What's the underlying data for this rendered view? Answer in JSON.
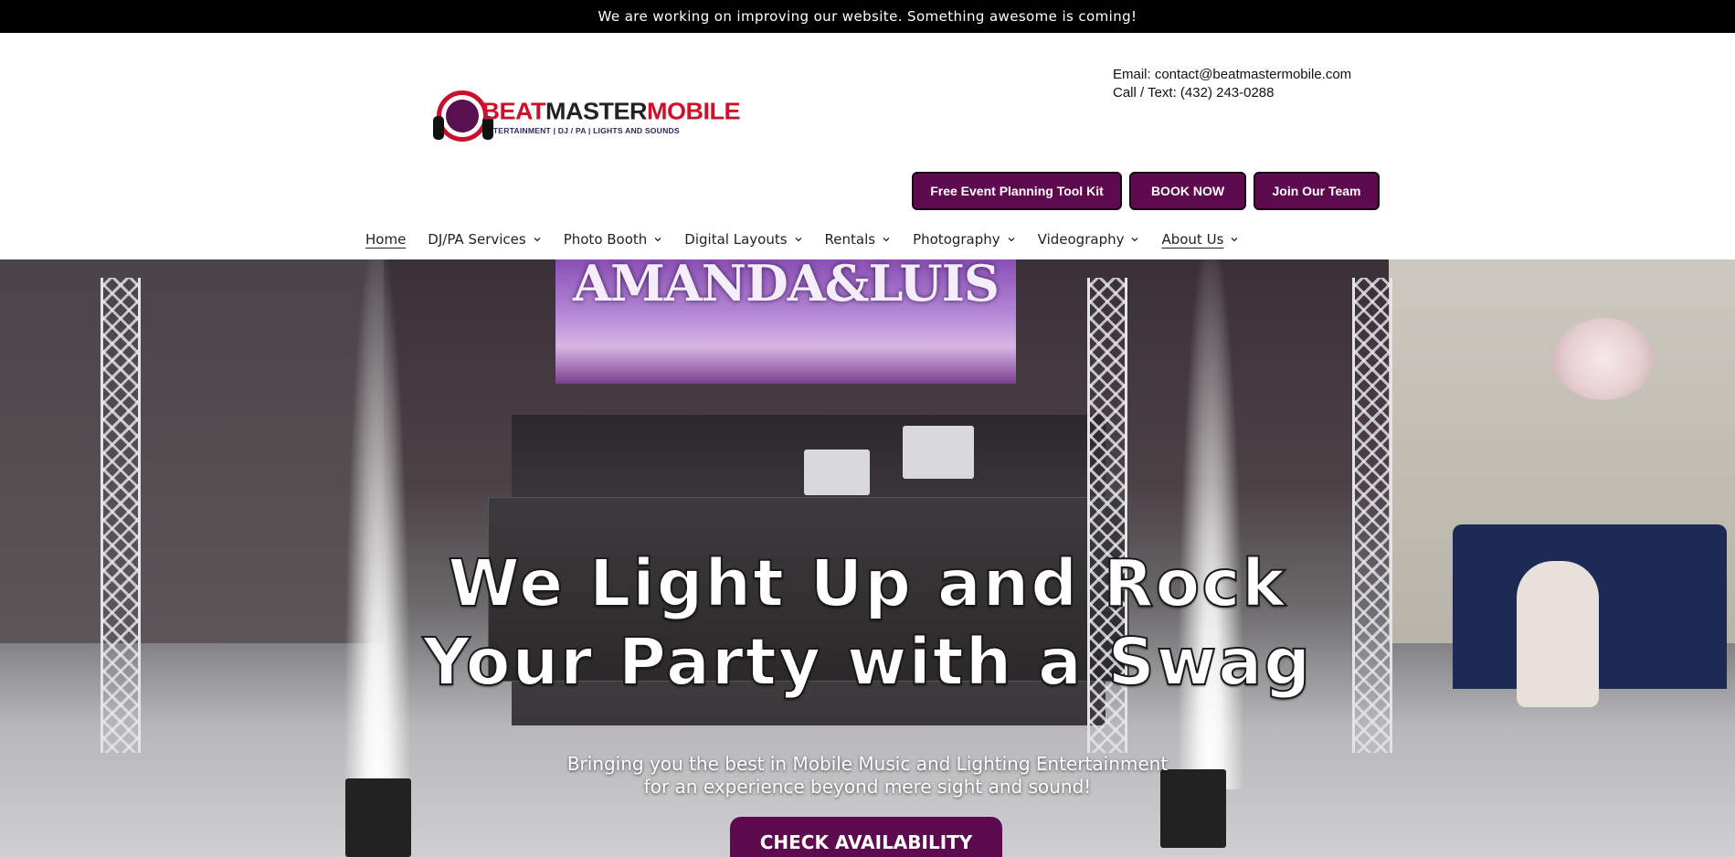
{
  "announcement": {
    "text": "We are working on improving our website. Something awesome is coming!"
  },
  "logo": {
    "brand_part1": "BEAT",
    "brand_part2": "MASTER",
    "brand_part3": "MOBILE",
    "tagline": "ENTERTAINMENT | DJ / PA | LIGHTS AND SOUNDS"
  },
  "contact": {
    "email_line": "Email: contact@beatmastermobile.com",
    "phone_line": "Call / Text: (432) 243-0288"
  },
  "cta_buttons": [
    {
      "label": "Free Event Planning Tool Kit"
    },
    {
      "label": "BOOK NOW"
    },
    {
      "label": "Join Our Team"
    }
  ],
  "nav": {
    "items": [
      {
        "label": "Home",
        "has_dropdown": false
      },
      {
        "label": "DJ/PA Services",
        "has_dropdown": true
      },
      {
        "label": "Photo Booth",
        "has_dropdown": true
      },
      {
        "label": "Digital Layouts",
        "has_dropdown": true
      },
      {
        "label": "Rentals",
        "has_dropdown": true
      },
      {
        "label": "Photography",
        "has_dropdown": true
      },
      {
        "label": "Videography",
        "has_dropdown": true
      },
      {
        "label": "About Us",
        "has_dropdown": true
      }
    ]
  },
  "hero": {
    "screen_text": "AMANDA&LUIS",
    "title_line1": "We Light Up and Rock",
    "title_line2": "Your Party with a Swag",
    "subtitle_line1": "Bringing you the best in Mobile Music and Lighting Entertainment",
    "subtitle_line2": "for an experience beyond mere sight and sound!",
    "cta_label": "CHECK AVAILABILITY"
  },
  "colors": {
    "brand_purple": "#5e0a4f",
    "brand_red": "#d0102a",
    "announcement_bg": "#000000"
  }
}
